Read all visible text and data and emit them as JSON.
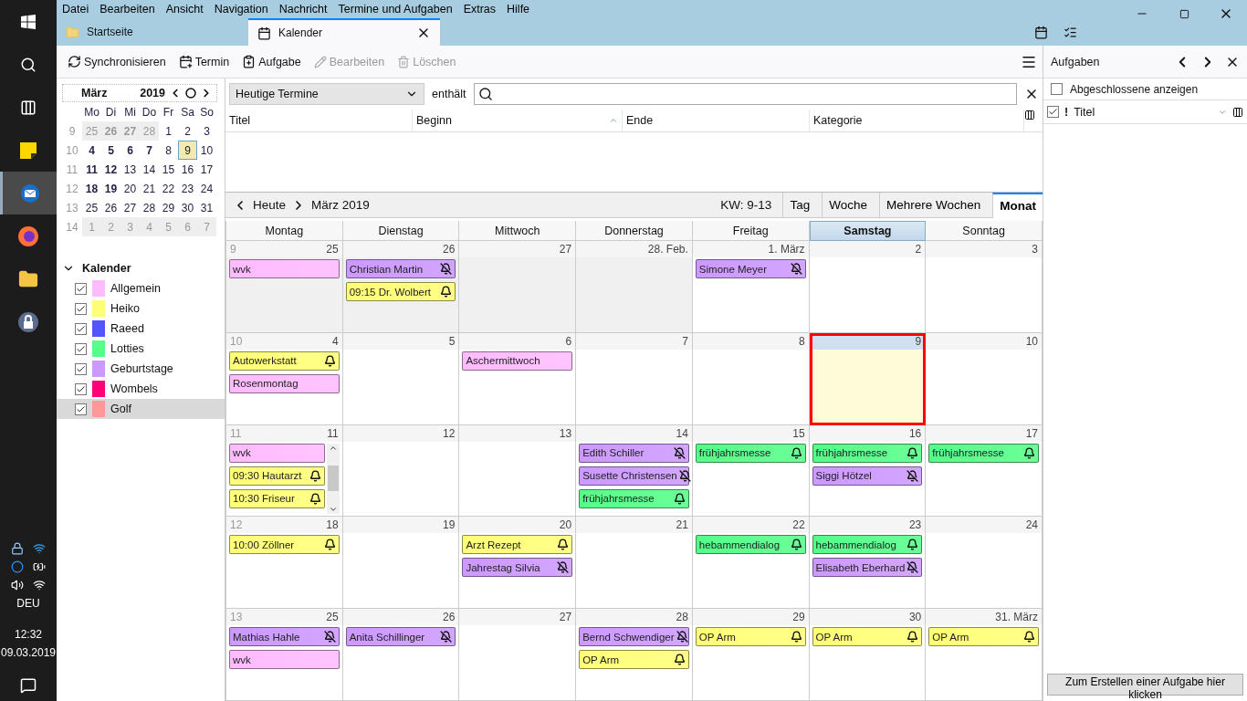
{
  "taskbar": {
    "apps": [
      {
        "kind": "windows",
        "selected": false
      },
      {
        "kind": "search",
        "selected": false
      },
      {
        "kind": "taskview",
        "selected": false
      },
      {
        "kind": "notes",
        "selected": false
      },
      {
        "kind": "mail",
        "selected": true
      },
      {
        "kind": "browser",
        "selected": false
      },
      {
        "kind": "folder",
        "selected": false
      },
      {
        "kind": "lock",
        "selected": false
      }
    ],
    "language": "DEU",
    "time": "12:32",
    "date": "09.03.2019"
  },
  "menu": [
    "Datei",
    "Bearbeiten",
    "Ansicht",
    "Navigation",
    "Nachricht",
    "Termine und Aufgaben",
    "Extras",
    "Hilfe"
  ],
  "tabs": [
    {
      "label": "Startseite",
      "kind": "home",
      "selected": false
    },
    {
      "label": "Kalender",
      "kind": "calendar",
      "selected": true
    }
  ],
  "toolbar": [
    {
      "label": "Synchronisieren",
      "kind": "sync",
      "disabled": false
    },
    {
      "label": "Termin",
      "kind": "event",
      "disabled": false
    },
    {
      "label": "Aufgabe",
      "kind": "task",
      "disabled": false
    },
    {
      "label": "Bearbeiten",
      "kind": "edit",
      "disabled": true
    },
    {
      "label": "Löschen",
      "kind": "delete",
      "disabled": true
    }
  ],
  "minical": {
    "month": "März",
    "year": "2019",
    "weekdays": [
      "Mo",
      "Di",
      "Mi",
      "Do",
      "Fr",
      "Sa",
      "So"
    ],
    "weeks": [
      {
        "week": "9",
        "days": [
          {
            "d": "25",
            "bold": false,
            "outside": true,
            "today": false
          },
          {
            "d": "26",
            "bold": true,
            "outside": true,
            "today": false
          },
          {
            "d": "27",
            "bold": true,
            "outside": true,
            "today": false
          },
          {
            "d": "28",
            "bold": false,
            "outside": true,
            "today": false
          },
          {
            "d": "1",
            "bold": false,
            "outside": false,
            "today": false
          },
          {
            "d": "2",
            "bold": false,
            "outside": false,
            "today": false
          },
          {
            "d": "3",
            "bold": false,
            "outside": false,
            "today": false
          }
        ]
      },
      {
        "week": "10",
        "days": [
          {
            "d": "4",
            "bold": true,
            "outside": false,
            "today": false
          },
          {
            "d": "5",
            "bold": true,
            "outside": false,
            "today": false
          },
          {
            "d": "6",
            "bold": true,
            "outside": false,
            "today": false
          },
          {
            "d": "7",
            "bold": true,
            "outside": false,
            "today": false
          },
          {
            "d": "8",
            "bold": false,
            "outside": false,
            "today": false
          },
          {
            "d": "9",
            "bold": false,
            "outside": false,
            "today": true
          },
          {
            "d": "10",
            "bold": false,
            "outside": false,
            "today": false
          }
        ]
      },
      {
        "week": "11",
        "days": [
          {
            "d": "11",
            "bold": true,
            "outside": false,
            "today": false
          },
          {
            "d": "12",
            "bold": true,
            "outside": false,
            "today": false
          },
          {
            "d": "13",
            "bold": false,
            "outside": false,
            "today": false
          },
          {
            "d": "14",
            "bold": false,
            "outside": false,
            "today": false
          },
          {
            "d": "15",
            "bold": false,
            "outside": false,
            "today": false
          },
          {
            "d": "16",
            "bold": false,
            "outside": false,
            "today": false
          },
          {
            "d": "17",
            "bold": false,
            "outside": false,
            "today": false
          }
        ]
      },
      {
        "week": "12",
        "days": [
          {
            "d": "18",
            "bold": true,
            "outside": false,
            "today": false
          },
          {
            "d": "19",
            "bold": true,
            "outside": false,
            "today": false
          },
          {
            "d": "20",
            "bold": false,
            "outside": false,
            "today": false
          },
          {
            "d": "21",
            "bold": false,
            "outside": false,
            "today": false
          },
          {
            "d": "22",
            "bold": false,
            "outside": false,
            "today": false
          },
          {
            "d": "23",
            "bold": false,
            "outside": false,
            "today": false
          },
          {
            "d": "24",
            "bold": false,
            "outside": false,
            "today": false
          }
        ]
      },
      {
        "week": "13",
        "days": [
          {
            "d": "25",
            "bold": false,
            "outside": false,
            "today": false
          },
          {
            "d": "26",
            "bold": false,
            "outside": false,
            "today": false
          },
          {
            "d": "27",
            "bold": false,
            "outside": false,
            "today": false
          },
          {
            "d": "28",
            "bold": false,
            "outside": false,
            "today": false
          },
          {
            "d": "29",
            "bold": false,
            "outside": false,
            "today": false
          },
          {
            "d": "30",
            "bold": false,
            "outside": false,
            "today": false
          },
          {
            "d": "31",
            "bold": false,
            "outside": false,
            "today": false
          }
        ]
      },
      {
        "week": "14",
        "days": [
          {
            "d": "1",
            "bold": false,
            "outside": true,
            "today": false
          },
          {
            "d": "2",
            "bold": false,
            "outside": true,
            "today": false
          },
          {
            "d": "3",
            "bold": false,
            "outside": true,
            "today": false
          },
          {
            "d": "4",
            "bold": false,
            "outside": true,
            "today": false
          },
          {
            "d": "5",
            "bold": false,
            "outside": true,
            "today": false
          },
          {
            "d": "6",
            "bold": false,
            "outside": true,
            "today": false
          },
          {
            "d": "7",
            "bold": false,
            "outside": true,
            "today": false
          }
        ]
      }
    ]
  },
  "calendars": {
    "title": "Kalender",
    "expanded": true,
    "items": [
      {
        "name": "Allgemein",
        "color": "#ffbbff",
        "checked": true,
        "selected": false
      },
      {
        "name": "Heiko",
        "color": "#ffff77",
        "checked": true,
        "selected": false
      },
      {
        "name": "Raeed",
        "color": "#5555ff",
        "checked": true,
        "selected": false
      },
      {
        "name": "Lotties",
        "color": "#55ff88",
        "checked": true,
        "selected": false
      },
      {
        "name": "Geburtstage",
        "color": "#cc99ff",
        "checked": true,
        "selected": false
      },
      {
        "name": "Wombels",
        "color": "#ff0077",
        "checked": true,
        "selected": false
      },
      {
        "name": "Golf",
        "color": "#ff9999",
        "checked": true,
        "selected": true
      }
    ]
  },
  "filter": {
    "value": "Heutige Termine",
    "operator": "enthält"
  },
  "list_columns": [
    {
      "label": "Titel",
      "sorted": false
    },
    {
      "label": "Beginn",
      "sorted": true
    },
    {
      "label": "Ende",
      "sorted": false
    },
    {
      "label": "Kategorie",
      "sorted": false
    }
  ],
  "nav": {
    "today": "Heute",
    "period": "März 2019",
    "weeks": "KW: 9-13",
    "views": [
      {
        "label": "Tag",
        "selected": false
      },
      {
        "label": "Woche",
        "selected": false
      },
      {
        "label": "Mehrere Wochen",
        "selected": false
      },
      {
        "label": "Monat",
        "selected": true
      }
    ]
  },
  "weekdays": [
    {
      "label": "Montag",
      "selected": false
    },
    {
      "label": "Dienstag",
      "selected": false
    },
    {
      "label": "Mittwoch",
      "selected": false
    },
    {
      "label": "Donnerstag",
      "selected": false
    },
    {
      "label": "Freitag",
      "selected": false
    },
    {
      "label": "Samstag",
      "selected": true
    },
    {
      "label": "Sonntag",
      "selected": false
    }
  ],
  "month": [
    {
      "week": "9",
      "days": [
        {
          "label": "25",
          "outside": true,
          "today": false,
          "events": [
            {
              "title": "wvk",
              "color": "#ffbbff"
            }
          ]
        },
        {
          "label": "26",
          "outside": true,
          "today": false,
          "events": [
            {
              "title": "Christian Martin",
              "color": "#cc99ff",
              "alarm": false
            },
            {
              "title": "09:15 Dr. Wolbert",
              "color": "#ffff77",
              "alarm": true
            }
          ]
        },
        {
          "label": "27",
          "outside": true,
          "today": false
        },
        {
          "label": "28. Feb.",
          "outside": true,
          "today": false
        },
        {
          "label": "1. März",
          "outside": false,
          "today": false,
          "events": [
            {
              "title": "Simone Meyer",
              "color": "#cc99ff",
              "alarm": false
            }
          ]
        },
        {
          "label": "2",
          "outside": false,
          "today": false
        },
        {
          "label": "3",
          "outside": false,
          "today": false
        }
      ]
    },
    {
      "week": "10",
      "days": [
        {
          "label": "4",
          "outside": false,
          "today": false,
          "events": [
            {
              "title": "Autowerkstatt",
              "color": "#ffff77",
              "alarm": true
            },
            {
              "title": "Rosenmontag",
              "color": "#ffbbff"
            }
          ]
        },
        {
          "label": "5",
          "outside": false,
          "today": false
        },
        {
          "label": "6",
          "outside": false,
          "today": false,
          "events": [
            {
              "title": "Aschermittwoch",
              "color": "#ffbbff"
            }
          ]
        },
        {
          "label": "7",
          "outside": false,
          "today": false
        },
        {
          "label": "8",
          "outside": false,
          "today": false
        },
        {
          "label": "9",
          "outside": false,
          "today": true
        },
        {
          "label": "10",
          "outside": false,
          "today": false
        }
      ]
    },
    {
      "week": "11",
      "days": [
        {
          "label": "11",
          "outside": false,
          "today": false,
          "scrollable": true,
          "events": [
            {
              "title": "wvk",
              "color": "#ffbbff"
            },
            {
              "title": "09:30 Hautarzt",
              "color": "#ffff77",
              "alarm": true
            },
            {
              "title": "10:30 Friseur",
              "color": "#ffff77",
              "alarm": true
            }
          ]
        },
        {
          "label": "12",
          "outside": false,
          "today": false
        },
        {
          "label": "13",
          "outside": false,
          "today": false
        },
        {
          "label": "14",
          "outside": false,
          "today": false,
          "events": [
            {
              "title": "Edith Schiller",
              "color": "#cc99ff",
              "alarm": false
            },
            {
              "title": "Susette Christensen",
              "color": "#cc99ff",
              "alarm": false
            },
            {
              "title": "frühjahrsmesse",
              "color": "#55ff88",
              "alarm": true
            }
          ]
        },
        {
          "label": "15",
          "outside": false,
          "today": false,
          "events": [
            {
              "title": "frühjahrsmesse",
              "color": "#55ff88",
              "alarm": true
            }
          ]
        },
        {
          "label": "16",
          "outside": false,
          "today": false,
          "events": [
            {
              "title": "frühjahrsmesse",
              "color": "#55ff88",
              "alarm": true
            },
            {
              "title": "Siggi Hötzel",
              "color": "#cc99ff",
              "alarm": false
            }
          ]
        },
        {
          "label": "17",
          "outside": false,
          "today": false,
          "events": [
            {
              "title": "frühjahrsmesse",
              "color": "#55ff88",
              "alarm": true
            }
          ]
        }
      ]
    },
    {
      "week": "12",
      "days": [
        {
          "label": "18",
          "outside": false,
          "today": false,
          "events": [
            {
              "title": "10:00 Zöllner",
              "color": "#ffff77",
              "alarm": true
            }
          ]
        },
        {
          "label": "19",
          "outside": false,
          "today": false
        },
        {
          "label": "20",
          "outside": false,
          "today": false,
          "events": [
            {
              "title": "Arzt Rezept",
              "color": "#ffff77",
              "alarm": true
            },
            {
              "title": "Jahrestag Silvia",
              "color": "#cc99ff",
              "alarm": false
            }
          ]
        },
        {
          "label": "21",
          "outside": false,
          "today": false
        },
        {
          "label": "22",
          "outside": false,
          "today": false,
          "events": [
            {
              "title": "hebammendialog",
              "color": "#55ff88",
              "alarm": true
            }
          ]
        },
        {
          "label": "23",
          "outside": false,
          "today": false,
          "events": [
            {
              "title": "hebammendialog",
              "color": "#55ff88",
              "alarm": true
            },
            {
              "title": "Elisabeth Eberhard",
              "color": "#cc99ff",
              "alarm": false
            }
          ]
        },
        {
          "label": "24",
          "outside": false,
          "today": false
        }
      ]
    },
    {
      "week": "13",
      "days": [
        {
          "label": "25",
          "outside": false,
          "today": false,
          "events": [
            {
              "title": "Mathias Hahle",
              "color": "#cc99ff",
              "alarm": false
            },
            {
              "title": "wvk",
              "color": "#ffbbff"
            }
          ]
        },
        {
          "label": "26",
          "outside": false,
          "today": false,
          "events": [
            {
              "title": "Anita Schillinger",
              "color": "#cc99ff",
              "alarm": false
            }
          ]
        },
        {
          "label": "27",
          "outside": false,
          "today": false
        },
        {
          "label": "28",
          "outside": false,
          "today": false,
          "events": [
            {
              "title": "Bernd Schwendiger",
              "color": "#cc99ff",
              "alarm": false
            },
            {
              "title": "OP Arm",
              "color": "#ffff77",
              "alarm": true
            }
          ]
        },
        {
          "label": "29",
          "outside": false,
          "today": false,
          "events": [
            {
              "title": "OP Arm",
              "color": "#ffff77",
              "alarm": true
            }
          ]
        },
        {
          "label": "30",
          "outside": false,
          "today": false,
          "events": [
            {
              "title": "OP Arm",
              "color": "#ffff77",
              "alarm": true
            }
          ]
        },
        {
          "label": "31. März",
          "outside": false,
          "today": false,
          "events": [
            {
              "title": "OP Arm",
              "color": "#ffff77",
              "alarm": true
            }
          ]
        }
      ]
    }
  ],
  "tasks": {
    "title": "Aufgaben",
    "show_completed": {
      "label": "Abgeschlossene anzeigen",
      "checked": false
    },
    "columns": [
      {
        "label": "!"
      },
      {
        "label": "Titel"
      }
    ],
    "all_checked": true,
    "create_button": "Zum Erstellen einer Aufgabe hier klicken"
  }
}
